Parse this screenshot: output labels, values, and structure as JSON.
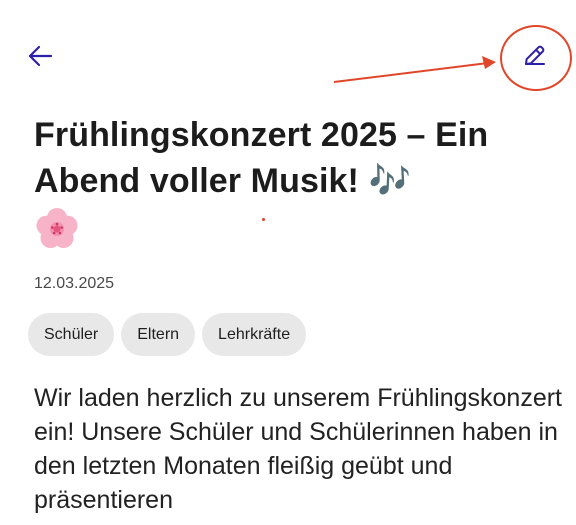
{
  "header": {
    "back_icon": "arrow-left-icon",
    "edit_icon": "pencil-icon",
    "accent_color": "#2e1fa8",
    "annotation_color": "#e0472a"
  },
  "article": {
    "title": "Frühlingskonzert 2025 – Ein Abend voller Musik!",
    "title_emoji": "🎶",
    "title_emoji_2": "🌸",
    "date": "12.03.2025",
    "tags": [
      "Schüler",
      "Eltern",
      "Lehrkräfte"
    ],
    "body": "Wir laden herzlich zu unserem Frühlingskonzert ein! Unsere Schüler und Schülerinnen haben in den letzten Monaten fleißig geübt und präsentieren"
  }
}
